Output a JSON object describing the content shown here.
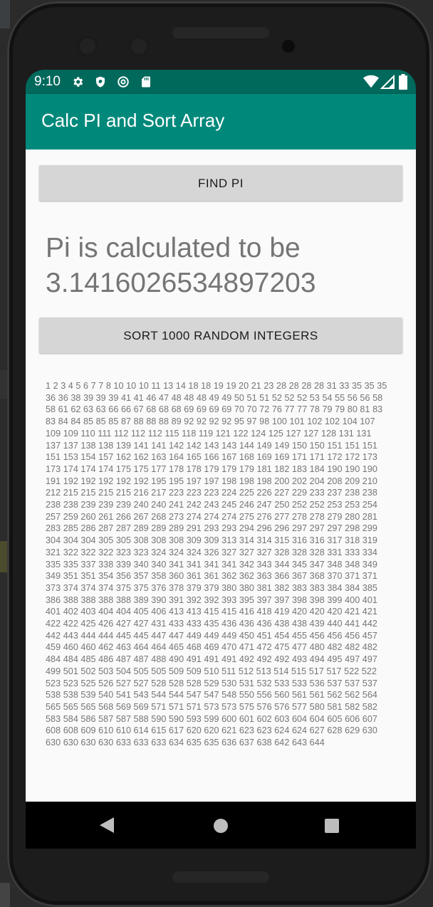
{
  "status_bar": {
    "time": "9:10",
    "icons": [
      "gear-icon",
      "shield-icon",
      "at-sign-icon",
      "sd-card-icon",
      "wifi-icon",
      "signal-icon",
      "battery-icon"
    ]
  },
  "app_bar": {
    "title": "Calc PI and Sort Array",
    "color": "#00897b",
    "status_color": "#00695c"
  },
  "main": {
    "find_pi_label": "FIND PI",
    "pi_result": "Pi is calculated to be 3.1416026534897203",
    "sort_label": "SORT 1000 RANDOM INTEGERS",
    "sorted_output": "1 2 3 4 5 6 7 7 8 10 10 10 11 13 14 18 18 19 19 20 21 23 28 28 28 28 31 33 35 35 35 36 36 38 39 39 39 41 41 46 47 48 48 48 49 49 50 51 51 52 52 52 53 54 55 56 56 58 58 61 62 63 63 66 66 67 68 68 68 69 69 69 69 70 70 72 76 77 77 78 79 79 80 81 83 83 84 84 85 85 85 87 88 88 88 89 92 92 92 92 95 97 98 100 101 102 102 104 107 109 109 110 111 112 112 112 115 118 119 121 122 124 125 127 127 128 131 131 137 137 138 138 139 141 141 142 142 143 143 144 149 149 150 150 151 151 151 151 153 154 157 162 162 163 164 165 166 167 168 169 169 171 171 172 172 173 173 174 174 174 175 175 177 178 178 179 179 179 181 182 183 184 190 190 190 191 192 192 192 192 192 195 195 197 197 198 198 198 200 202 204 208 209 210 212 215 215 215 215 216 217 223 223 223 224 225 226 227 229 233 237 238 238 238 238 239 239 239 240 240 241 242 243 245 246 247 250 252 252 253 253 254 257 259 260 261 266 267 268 273 274 274 274 275 276 277 278 278 279 280 281 283 285 286 287 287 289 289 289 291 293 293 294 296 296 297 297 297 298 299 304 304 304 305 305 308 308 308 309 309 313 314 314 315 316 316 317 318 319 321 322 322 322 323 323 324 324 324 326 327 327 327 328 328 328 331 333 334 335 335 337 338 339 340 340 341 341 341 341 342 343 344 345 347 348 348 349 349 351 351 354 356 357 358 360 361 361 362 362 363 366 367 368 370 371 371 373 374 374 374 375 375 376 378 379 379 380 380 381 382 383 383 384 384 385 386 388 388 388 388 389 390 391 392 392 393 395 397 397 398 398 399 400 401 401 402 403 404 404 405 406 413 413 415 415 416 418 419 420 420 420 421 421 422 422 425 426 427 427 431 433 433 435 436 436 436 438 438 439 440 441 442 442 443 444 444 445 445 447 447 449 449 449 450 451 454 455 456 456 456 457 459 460 460 462 463 464 464 465 468 469 470 471 472 475 477 480 482 482 482 484 484 485 486 487 487 488 490 491 491 491 492 492 492 493 494 495 497 497 499 501 502 503 504 505 505 509 509 510 511 512 513 514 515 517 517 522 522 523 523 525 526 527 527 528 528 528 529 530 531 532 533 533 536 537 537 537 538 538 539 540 541 543 544 544 547 547 548 550 556 560 561 561 562 562 564 565 565 565 568 569 569 571 571 571 573 573 575 576 576 577 580 581 582 582 583 584 586 587 587 588 590 590 593 599 600 601 602 603 604 604 605 606 607 608 608 609 610 610 614 615 617 620 620 621 623 623 624 624 627 628 629 630 630 630 630 630 633 633 633 634 635 635 636 637 638 642 643 644"
  },
  "nav_bar": {
    "icons": [
      "back-icon",
      "home-icon",
      "recents-icon"
    ]
  }
}
